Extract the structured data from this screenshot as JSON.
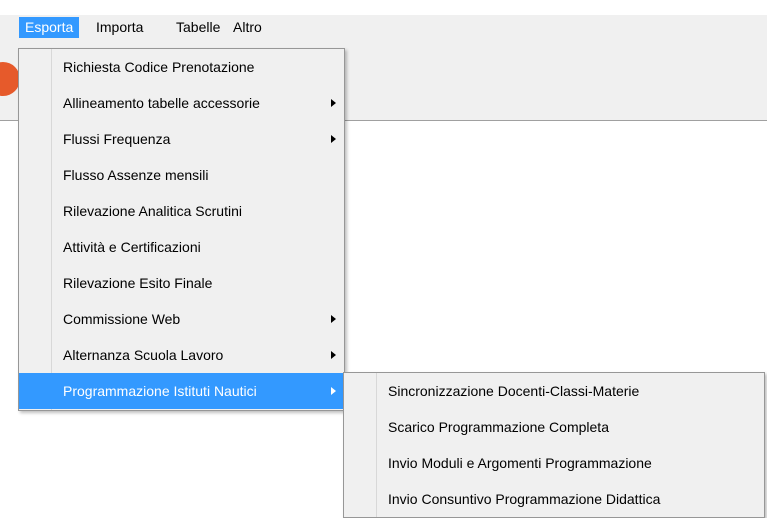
{
  "menubar": {
    "items": [
      {
        "label": "Esporta"
      },
      {
        "label": "Importa"
      },
      {
        "label": "Tabelle"
      },
      {
        "label": "Altro"
      }
    ]
  },
  "esporta_menu": {
    "items": [
      {
        "label": "Richiesta Codice Prenotazione"
      },
      {
        "label": "Allineamento tabelle accessorie"
      },
      {
        "label": "Flussi Frequenza"
      },
      {
        "label": "Flusso Assenze mensili"
      },
      {
        "label": "Rilevazione Analitica Scrutini"
      },
      {
        "label": "Attività e Certificazioni"
      },
      {
        "label": "Rilevazione Esito Finale"
      },
      {
        "label": "Commissione Web"
      },
      {
        "label": "Alternanza Scuola Lavoro"
      },
      {
        "label": "Programmazione Istituti Nautici"
      }
    ]
  },
  "nautici_submenu": {
    "items": [
      {
        "label": "Sincronizzazione Docenti-Classi-Materie"
      },
      {
        "label": "Scarico Programmazione Completa"
      },
      {
        "label": "Invio Moduli e Argomenti Programmazione"
      },
      {
        "label": "Invio Consuntivo Programmazione Didattica"
      }
    ]
  },
  "colors": {
    "highlight": "#3399ff",
    "menu_background": "#f0f0f0",
    "logo": "#e65a2b"
  },
  "icons": {
    "submenu_arrow": "chevron-right-icon",
    "app_logo": "app-logo-icon"
  }
}
